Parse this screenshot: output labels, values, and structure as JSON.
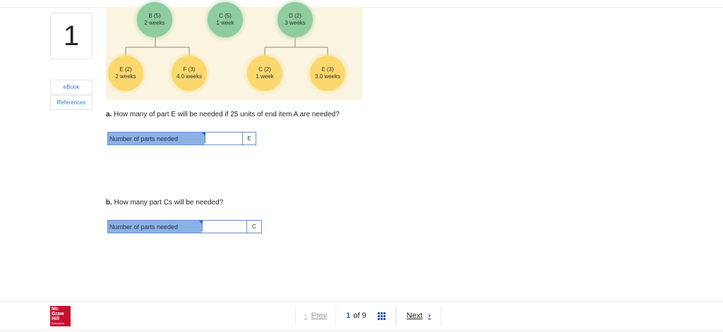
{
  "question": {
    "number": "1"
  },
  "sidebar": {
    "ebook": "eBook",
    "references": "References"
  },
  "figure": {
    "top_nodes": [
      {
        "name": "B (5)",
        "time": "2 weeks"
      },
      {
        "name": "C (5)",
        "time": "1 week"
      },
      {
        "name": "D (2)",
        "time": "3 weeks"
      }
    ],
    "bottom_nodes": [
      {
        "name": "E (2)",
        "time": "2 weeks"
      },
      {
        "name": "F (3)",
        "time": "4.0 weeks"
      },
      {
        "name": "C (2)",
        "time": "1 week"
      },
      {
        "name": "E (3)",
        "time": "3.0 weeks"
      }
    ]
  },
  "part_a": {
    "label": "a.",
    "text": " How many of part E will be needed if 25 units of end item A are needed?",
    "field_label": "Number of parts needed",
    "value": "",
    "unit": "E"
  },
  "part_b": {
    "label": "b.",
    "text": " How many part Cs will be needed?",
    "field_label": "Number of parts needed",
    "value": "",
    "unit": "C"
  },
  "footer": {
    "logo_lines": [
      "Mc",
      "Graw",
      "Hill"
    ],
    "logo_sub": "Education",
    "prev": "Prev",
    "current_page": "1",
    "of_text": "of 9",
    "next": "Next"
  },
  "colors": {
    "accent": "#2a5ab0",
    "green_node": "#8fcc9e",
    "yellow_node": "#fbd86e",
    "field_label_bg": "#8bb2e6"
  }
}
